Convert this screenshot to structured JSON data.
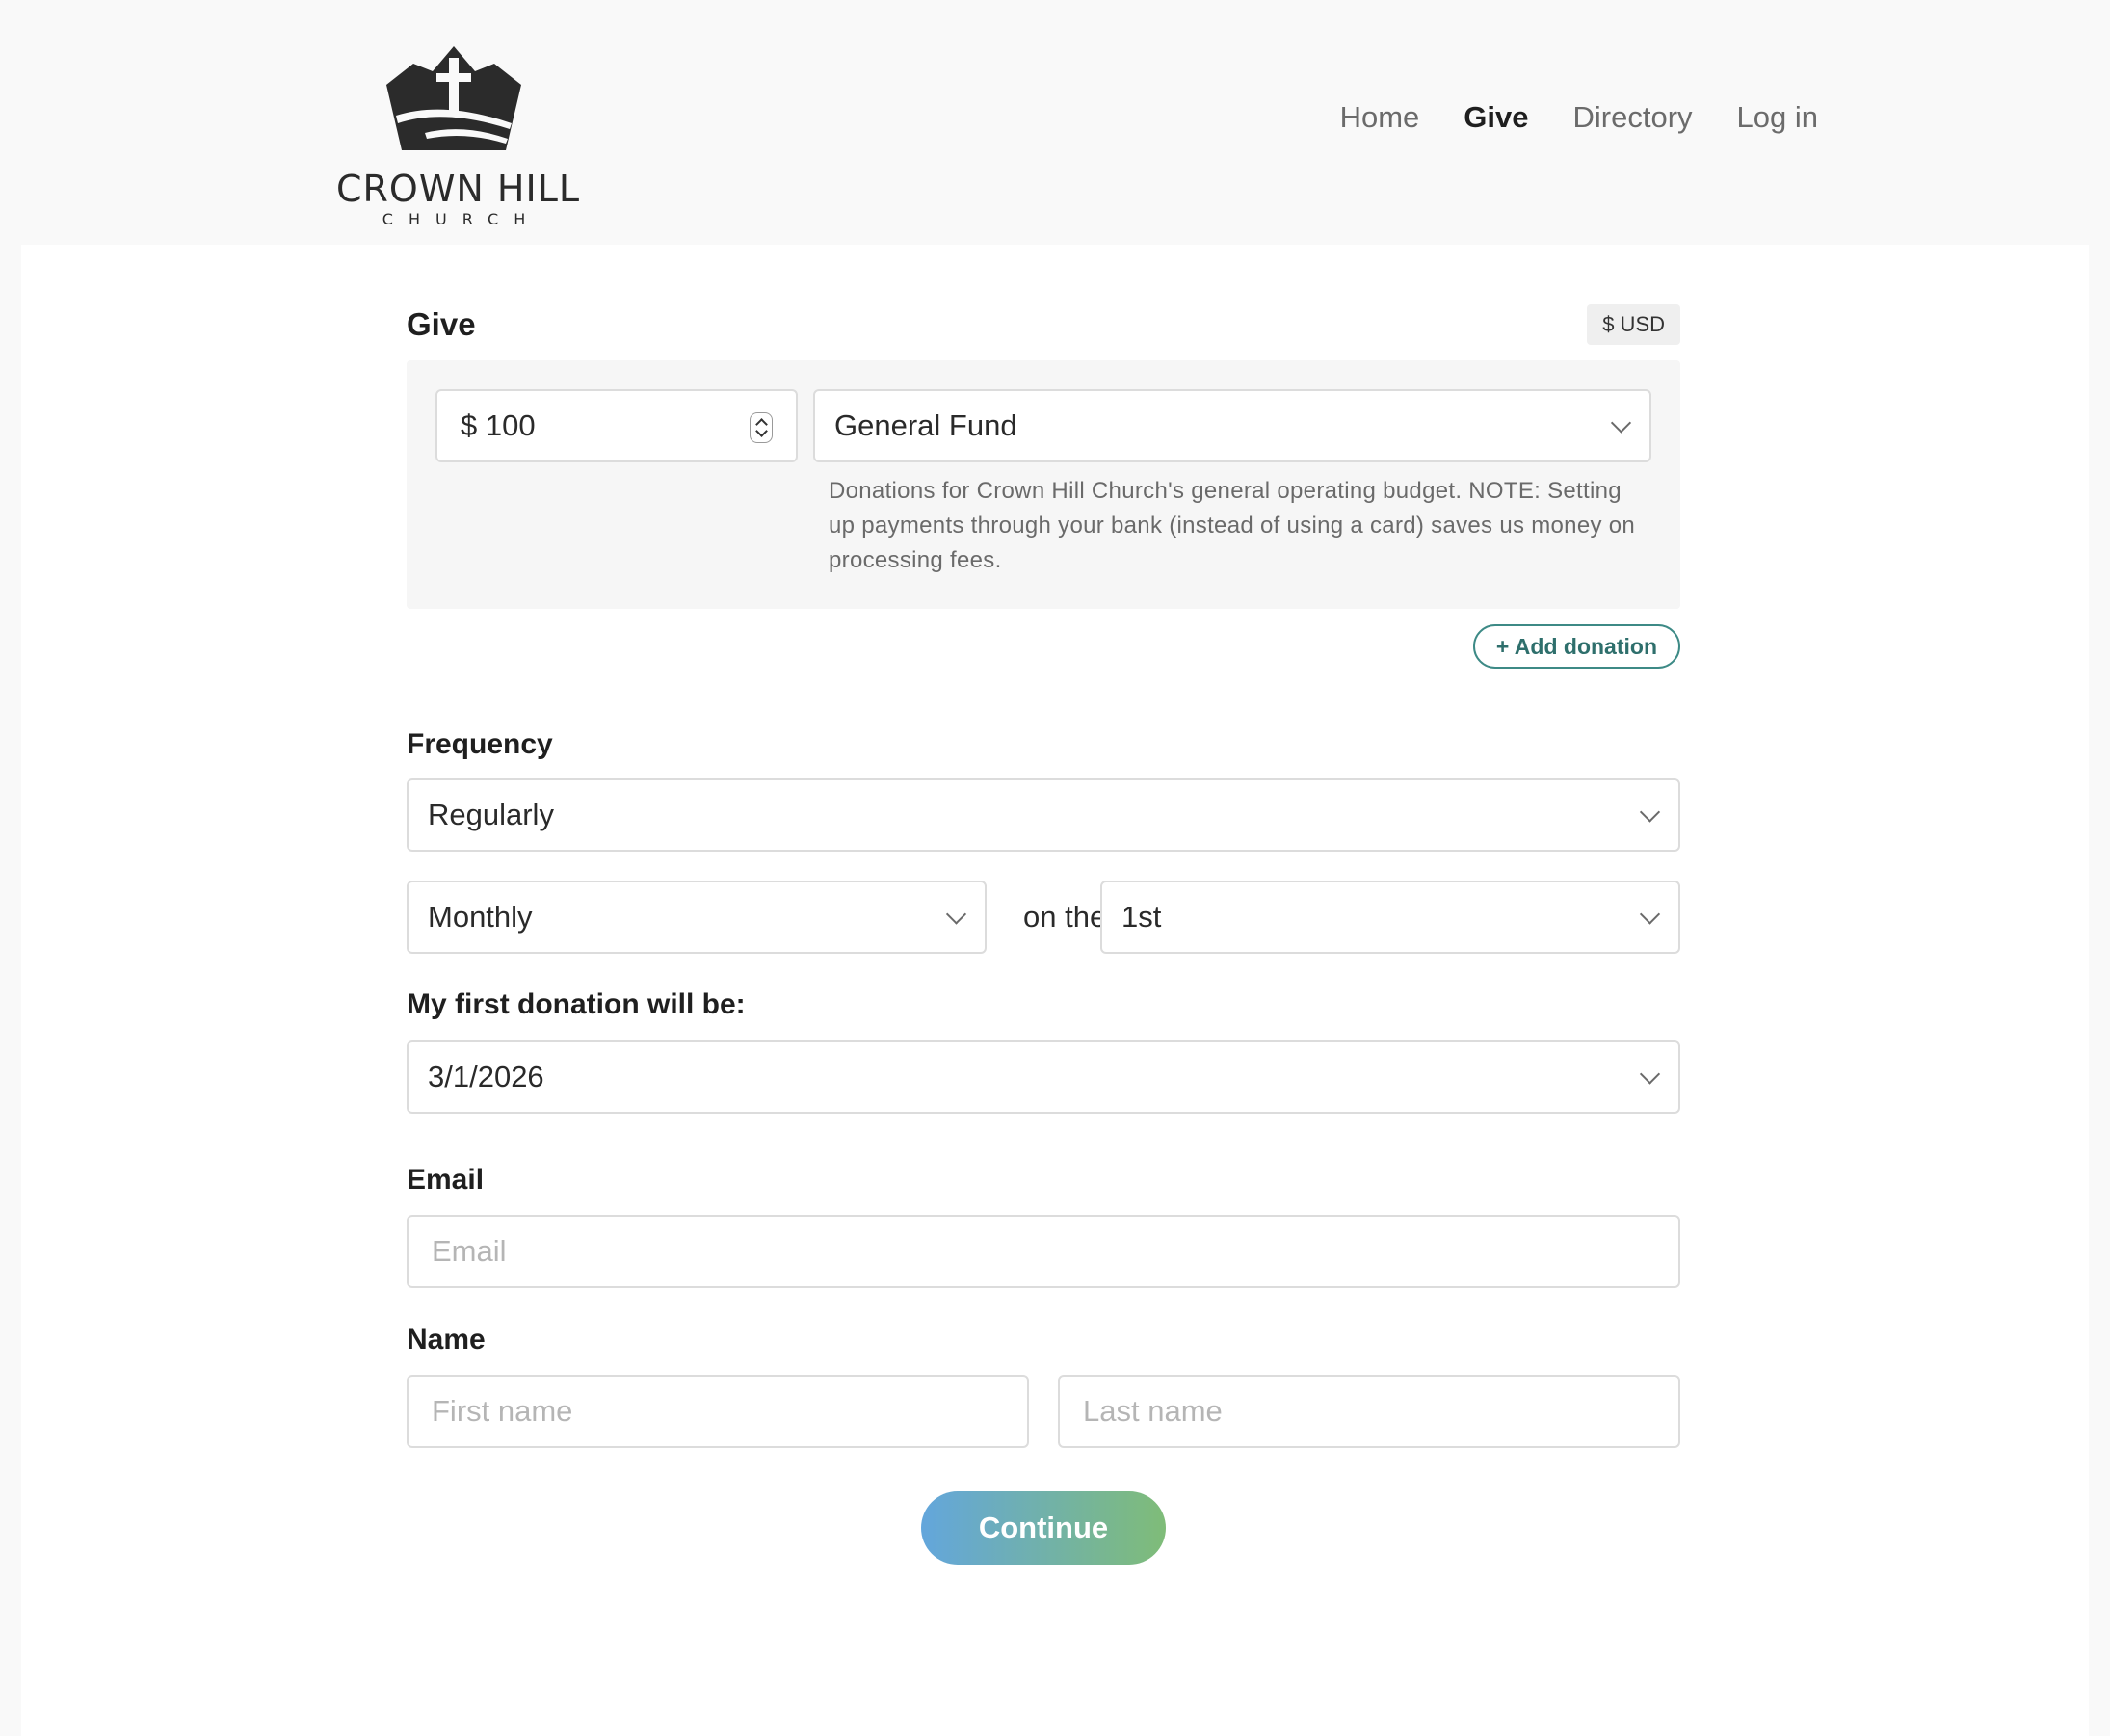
{
  "brand": {
    "name": "CROWN HILL",
    "sub": "C H U R C H"
  },
  "nav": {
    "items": [
      {
        "label": "Home"
      },
      {
        "label": "Give",
        "active": true
      },
      {
        "label": "Directory"
      },
      {
        "label": "Log in"
      }
    ]
  },
  "give": {
    "title": "Give",
    "currency": "$ USD",
    "amount": "$ 100",
    "fund": "General Fund",
    "fund_description": "Donations for Crown Hill Church's general operating budget. NOTE: Setting up payments through your bank (instead of using a card) saves us money on processing fees.",
    "add_donation_label": "+ Add donation"
  },
  "frequency": {
    "label": "Frequency",
    "value": "Regularly",
    "period": "Monthly",
    "connector": "on the",
    "day": "1st"
  },
  "first_donation": {
    "label": "My first donation will be:",
    "date": "3/1/2026"
  },
  "email": {
    "label": "Email",
    "placeholder": "Email"
  },
  "name": {
    "label": "Name",
    "first_placeholder": "First name",
    "last_placeholder": "Last name"
  },
  "continue_label": "Continue",
  "colors": {
    "accent_teal": "#3d8a86",
    "button_gradient_start": "#63a6dc",
    "button_gradient_end": "#7fbc78"
  }
}
